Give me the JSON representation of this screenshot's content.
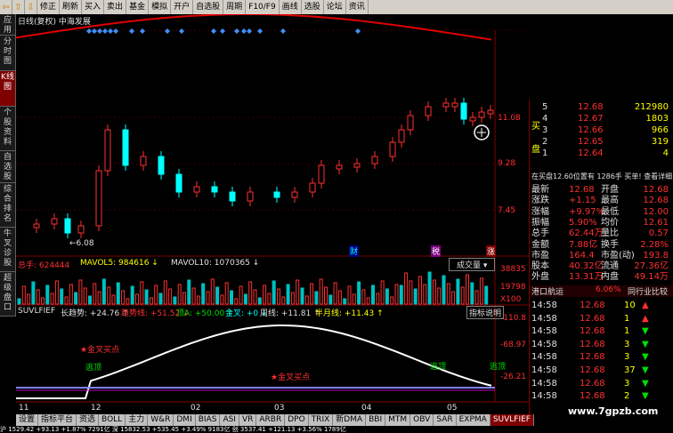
{
  "toolbar": {
    "items": [
      "修正",
      "刷新",
      "买入",
      "卖出",
      "基金",
      "模拟",
      "开户",
      "自选股",
      "周期",
      "F10/F9",
      "画线",
      "选股",
      "论坛",
      "资讯"
    ]
  },
  "sidebar": {
    "tabs": [
      "应用",
      "分时图",
      "K线图",
      "个股资料",
      "自选股",
      "综合排名",
      "牛叉诊股",
      "超级盘口"
    ],
    "active_index": 2
  },
  "main_chart": {
    "title": "日线(复权)  中海发展",
    "price_labels": [
      "11.08",
      "9.28",
      "7.45"
    ],
    "low_marker": "6.08",
    "markers": [
      "财",
      "税",
      "涨"
    ],
    "x_labels": [
      "11",
      "12",
      "02",
      "03",
      "04",
      "05"
    ]
  },
  "volume": {
    "label_total": "总手: 624444",
    "label_ma5": "MAVOL5: 984616",
    "label_ma10": "MAVOL10: 1070365",
    "button": "成交量",
    "y_labels": [
      "38835",
      "19798",
      "X100"
    ]
  },
  "indicator": {
    "name": "SUVLFIEF",
    "l1": "长趋势: +24.76",
    "l2": "趋势线: +51.52",
    "l3": "顶A: +50.00",
    "l4": "金叉: +0",
    "l5": "周线: +11.81",
    "l6": "半月线: +11.43",
    "button": "指标说明",
    "y_labels": [
      "110.8",
      "68.97",
      "26.21"
    ],
    "annotations": [
      "金叉买点",
      "金叉买点",
      "逃顶",
      "逃顶",
      "逃顶"
    ]
  },
  "order_book": {
    "sell": [
      {
        "level": "5",
        "price": "12.68",
        "vol": "212980"
      },
      {
        "level": "4",
        "price": "12.67",
        "vol": "1803"
      },
      {
        "level": "3",
        "price": "12.66",
        "vol": "966"
      },
      {
        "level": "2",
        "price": "12.65",
        "vol": "319"
      },
      {
        "level": "1",
        "price": "12.64",
        "vol": "4"
      }
    ],
    "side_label_1": "买",
    "side_label_2": "盘",
    "status_line": "在买盘12.60位置有 1286手 买单! 查看详细"
  },
  "stats": [
    {
      "k": "最新",
      "v": "12.68",
      "k2": "开盘",
      "v2": "12.68"
    },
    {
      "k": "涨跌",
      "v": "+1.15",
      "k2": "最高",
      "v2": "12.68"
    },
    {
      "k": "涨幅",
      "v": "+9.97%",
      "k2": "最低",
      "v2": "12.00"
    },
    {
      "k": "振幅",
      "v": "5.90%",
      "k2": "均价",
      "v2": "12.61"
    },
    {
      "k": "总手",
      "v": "62.44万",
      "k2": "量比",
      "v2": "0.57"
    },
    {
      "k": "金额",
      "v": "7.88亿",
      "k2": "换手",
      "v2": "2.28%"
    },
    {
      "k": "市盈",
      "v": "164.4",
      "k2": "市盈(动)",
      "v2": "193.8"
    },
    {
      "k": "股本",
      "v": "40.32亿",
      "k2": "流通",
      "v2": "27.36亿"
    },
    {
      "k": "外盘",
      "v": "13.31万",
      "k2": "内盘",
      "v2": "49.14万"
    }
  ],
  "sector": {
    "name": "港口航运",
    "pct": "6.06%",
    "link": "同行业比较"
  },
  "ticks": [
    {
      "t": "14:58",
      "p": "12.68",
      "v": "10"
    },
    {
      "t": "14:58",
      "p": "12.68",
      "v": "1"
    },
    {
      "t": "14:58",
      "p": "12.68",
      "v": "1"
    },
    {
      "t": "14:58",
      "p": "12.68",
      "v": "3"
    },
    {
      "t": "14:58",
      "p": "12.68",
      "v": "3"
    },
    {
      "t": "14:58",
      "p": "12.68",
      "v": "37"
    },
    {
      "t": "14:58",
      "p": "12.68",
      "v": "3"
    },
    {
      "t": "14:58",
      "p": "12.68",
      "v": "2"
    }
  ],
  "bottom_tabs": [
    "设置",
    "指标平台",
    "资选",
    "BOLL",
    "主力",
    "W&R",
    "DMI",
    "BIAS",
    "ASI",
    "VR",
    "ARBR",
    "DPO",
    "TRIX",
    "新DMA",
    "BBI",
    "MTM",
    "OBV",
    "SAR",
    "EXPMA",
    "SUVLFIEF"
  ],
  "bottom_active": "SUVLFIEF",
  "watermark": "www.7gpzb.com",
  "status_text": "沪 1529.42  +93.13  +1.87%   7291亿  深 15832.53  +535.45  +3.49%   9183亿  创 3537.41  +121.13  +3.56%   1789亿"
}
